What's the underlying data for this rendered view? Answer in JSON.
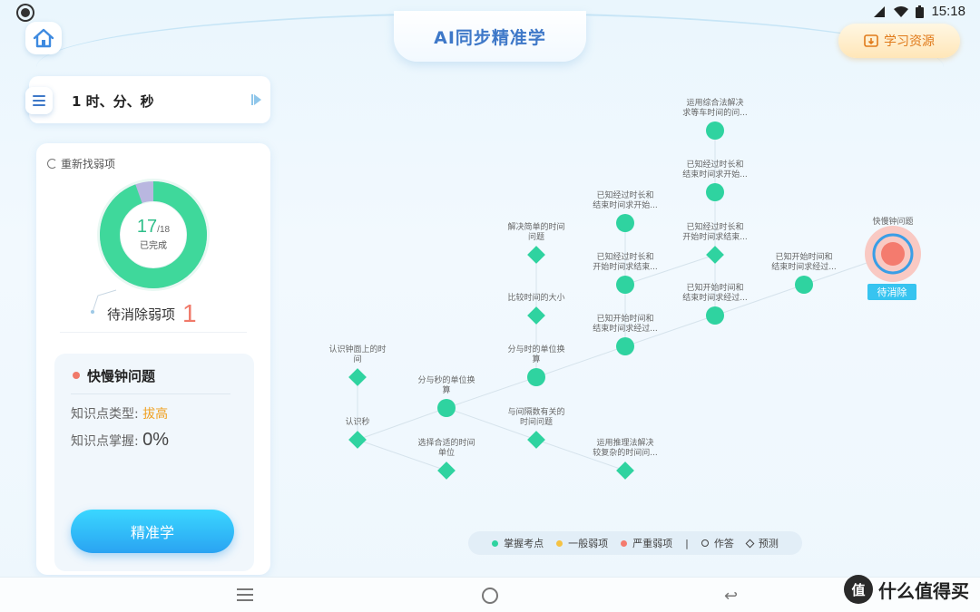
{
  "status_bar": {
    "time": "15:18"
  },
  "header": {
    "title": "AI同步精准学",
    "resource_label": "学习资源"
  },
  "unit": {
    "name": "1 时、分、秒"
  },
  "left_panel": {
    "refresh_label": "重新找弱项",
    "progress": {
      "done": "17",
      "total": "/18",
      "label": "已完成",
      "fraction": 0.944
    },
    "pending_label": "待消除弱项",
    "pending_count": "1"
  },
  "detail": {
    "title": "快慢钟问题",
    "type_label": "知识点类型:",
    "type_value": "拔高",
    "mastery_label": "知识点掌握:",
    "mastery_value": "0%",
    "button_label": "精准学"
  },
  "graph": {
    "nodes": [
      {
        "label1": "运用综合法解决",
        "label2": "求等车时间的问...",
        "shape": "circle",
        "status": "mastered"
      },
      {
        "label1": "已知经过时长和",
        "label2": "结束时间求开始...",
        "shape": "circle",
        "status": "mastered"
      },
      {
        "label1": "已知经过时长和",
        "label2": "结束时间求开始...",
        "shape": "circle",
        "status": "mastered"
      },
      {
        "label1": "解决简单的时间",
        "label2": "问题",
        "shape": "diamond",
        "status": "mastered"
      },
      {
        "label1": "已知经过时长和",
        "label2": "开始时间求结束...",
        "shape": "diamond",
        "status": "mastered"
      },
      {
        "label1": "已知经过时长和",
        "label2": "开始时间求结束...",
        "shape": "circle",
        "status": "mastered"
      },
      {
        "label1": "比较时间的大小",
        "label2": "",
        "shape": "diamond",
        "status": "mastered"
      },
      {
        "label1": "已知开始时间和",
        "label2": "结束时间求经过...",
        "shape": "circle",
        "status": "mastered"
      },
      {
        "label1": "已知开始时间和",
        "label2": "结束时间求经过...",
        "shape": "circle",
        "status": "mastered"
      },
      {
        "label1": "已知开始时间和",
        "label2": "结束时间求经过...",
        "shape": "circle",
        "status": "mastered"
      },
      {
        "label1": "快慢钟问题",
        "label2": "",
        "shape": "circle",
        "status": "severe"
      },
      {
        "label1": "认识钟面上的时",
        "label2": "间",
        "shape": "diamond",
        "status": "mastered"
      },
      {
        "label1": "分与时的单位换",
        "label2": "算",
        "shape": "circle",
        "status": "mastered"
      },
      {
        "label1": "分与秒的单位换",
        "label2": "算",
        "shape": "circle",
        "status": "mastered"
      },
      {
        "label1": "认识秒",
        "label2": "",
        "shape": "diamond",
        "status": "mastered"
      },
      {
        "label1": "与间隔数有关的",
        "label2": "时间问题",
        "shape": "diamond",
        "status": "mastered"
      },
      {
        "label1": "选择合适的时间",
        "label2": "单位",
        "shape": "diamond",
        "status": "mastered"
      },
      {
        "label1": "运用推理法解决",
        "label2": "较复杂的时间问...",
        "shape": "diamond",
        "status": "mastered"
      }
    ],
    "pending_tag": "待消除",
    "colors": {
      "mastered": "#2fd3a0",
      "normal": "#f5c242",
      "severe": "#f47b6e",
      "edge": "#d6e3ec"
    }
  },
  "legend": {
    "mastered": "掌握考点",
    "normal": "一般弱项",
    "severe": "严重弱项",
    "sep": "|",
    "answered": "作答",
    "predicted": "预测"
  },
  "watermark": {
    "logo": "值",
    "text": "什么值得买"
  }
}
